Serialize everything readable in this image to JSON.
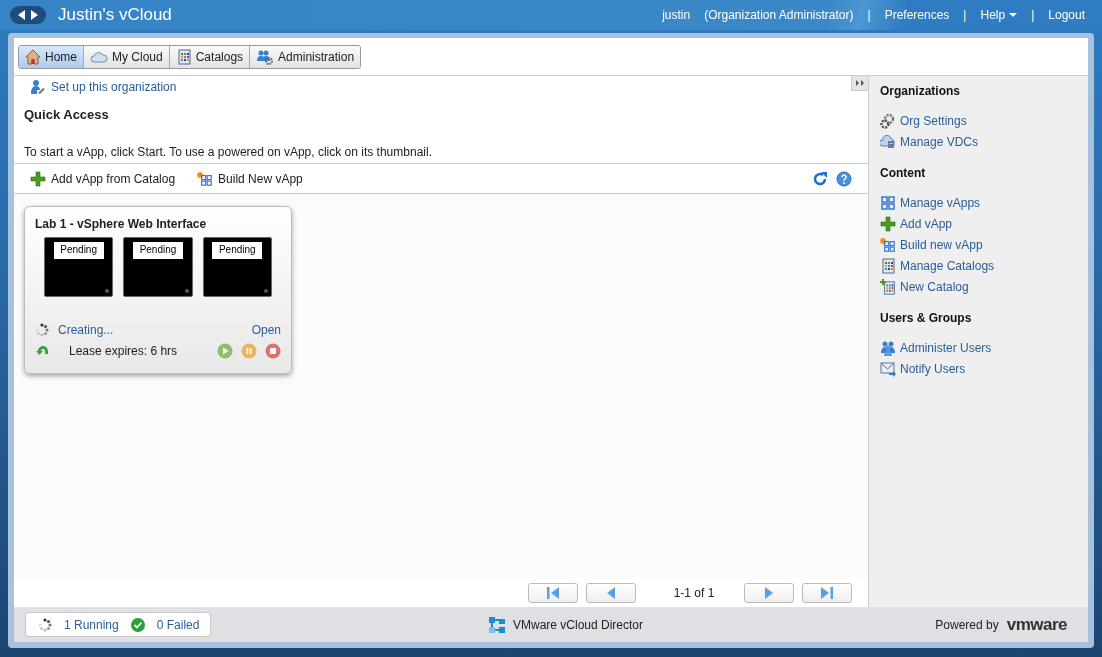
{
  "header": {
    "title": "Justin's vCloud",
    "links": [
      {
        "kind": "text",
        "label": "justin"
      },
      {
        "kind": "text",
        "label": "(Organization Administrator)"
      },
      {
        "kind": "separator",
        "label": "|"
      },
      {
        "kind": "link",
        "label": "Preferences"
      },
      {
        "kind": "separator",
        "label": "|"
      },
      {
        "kind": "menu",
        "label": "Help"
      },
      {
        "kind": "separator",
        "label": "|"
      },
      {
        "kind": "link",
        "label": "Logout"
      }
    ]
  },
  "tabs": [
    {
      "label": "Home",
      "selected": true
    },
    {
      "label": "My Cloud",
      "selected": false
    },
    {
      "label": "Catalogs",
      "selected": false
    },
    {
      "label": "Administration",
      "selected": false
    }
  ],
  "setup_link": "Set up this organization",
  "quick_access": {
    "title": "Quick Access",
    "description": "To start a vApp, click Start. To use a powered on vApp, click on its thumbnail."
  },
  "toolbar": [
    "Add vApp from Catalog",
    "Build New vApp"
  ],
  "vapps": [
    {
      "name": "Lab 1 - vSphere Web Interface",
      "vms": [
        "Pending",
        "Pending",
        "Pending"
      ],
      "status": "Creating...",
      "open": "Open",
      "lease": "Lease expires: 6 hrs"
    }
  ],
  "pager": {
    "text": "1-1 of 1"
  },
  "sidebar": [
    {
      "title": "Organizations",
      "items": [
        "Org Settings",
        "Manage VDCs"
      ]
    },
    {
      "title": "Content",
      "items": [
        "Manage vApps",
        "Add vApp",
        "Build new vApp",
        "Manage Catalogs",
        "New Catalog"
      ]
    },
    {
      "title": "Users & Groups",
      "items": [
        "Administer Users",
        "Notify Users"
      ]
    }
  ],
  "footer": {
    "running": "1 Running",
    "failed": "0 Failed",
    "product": "VMware vCloud Director",
    "powered_by": "Powered by",
    "logo": "vmware"
  }
}
